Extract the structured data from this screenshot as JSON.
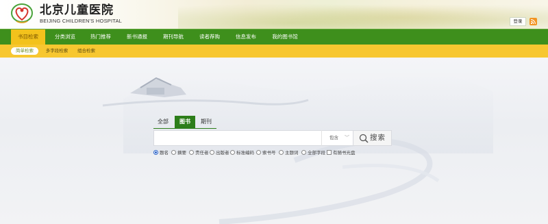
{
  "header": {
    "hospital_name": "北京儿童医院",
    "hospital_name_en": "BEIJING CHILDREN'S HOSPITAL",
    "login_label": "登录",
    "rss_icon": "rss-icon",
    "logo_icon": "hospital-logo-icon"
  },
  "nav": {
    "items": [
      {
        "label": "书目检索",
        "active": true
      },
      {
        "label": "分类浏览",
        "active": false
      },
      {
        "label": "热门推荐",
        "active": false
      },
      {
        "label": "新书通报",
        "active": false
      },
      {
        "label": "期刊导航",
        "active": false
      },
      {
        "label": "读者荐购",
        "active": false
      },
      {
        "label": "信息发布",
        "active": false
      },
      {
        "label": "我的图书馆",
        "active": false
      }
    ]
  },
  "subnav": {
    "items": [
      {
        "label": "简单检索",
        "active": true
      },
      {
        "label": "多字段检索",
        "active": false
      },
      {
        "label": "组合检索",
        "active": false
      }
    ]
  },
  "search": {
    "tabs": [
      {
        "label": "全部",
        "active": false
      },
      {
        "label": "图书",
        "active": true
      },
      {
        "label": "期刊",
        "active": false
      }
    ],
    "input_value": "",
    "match_select": "包含",
    "button_label": "搜索",
    "fields": [
      {
        "label": "题名",
        "type": "radio",
        "checked": true
      },
      {
        "label": "摘要",
        "type": "radio",
        "checked": false
      },
      {
        "label": "责任者",
        "type": "radio",
        "checked": false
      },
      {
        "label": "出版者",
        "type": "radio",
        "checked": false
      },
      {
        "label": "标准编码",
        "type": "radio",
        "checked": false
      },
      {
        "label": "索书号",
        "type": "radio",
        "checked": false
      },
      {
        "label": "主题词",
        "type": "radio",
        "checked": false
      },
      {
        "label": "全部字段",
        "type": "radio",
        "checked": false
      },
      {
        "label": "有随书光盘",
        "type": "checkbox",
        "checked": false
      }
    ]
  },
  "colors": {
    "nav_green": "#3e8f1c",
    "nav_active_yellow": "#f3c21c",
    "subnav_yellow": "#f7c730",
    "tab_active_green": "#2d7e1a"
  }
}
